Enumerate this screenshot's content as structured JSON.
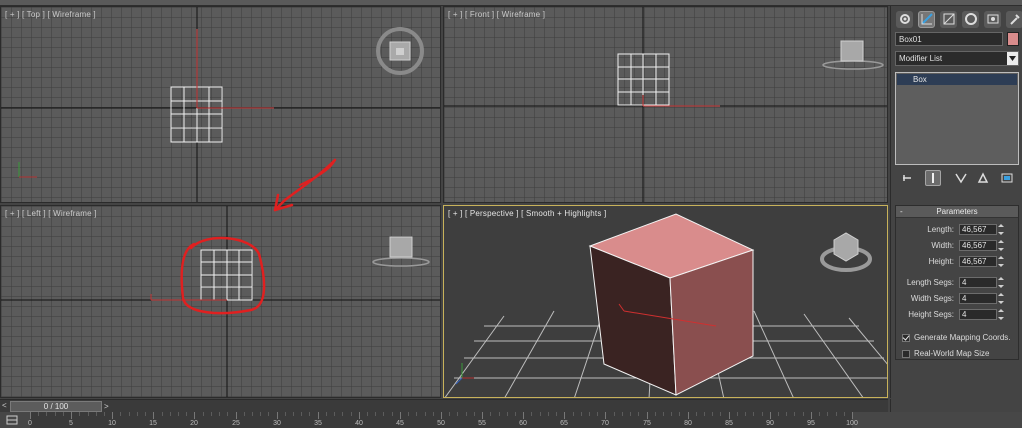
{
  "viewports": {
    "top": {
      "label": "[ + ] [ Top ] [ Wireframe ]"
    },
    "front": {
      "label": "[ + ] [ Front ] [ Wireframe ]"
    },
    "left": {
      "label": "[ + ] [ Left ] [ Wireframe ]"
    },
    "perspective": {
      "label": "[ + ] [ Perspective ] [ Smooth + Highlights ]"
    }
  },
  "command_panel": {
    "tabs": [
      "create-icon",
      "modify-icon",
      "hierarchy-icon",
      "motion-icon",
      "display-icon",
      "utilities-icon"
    ],
    "active_tab": "modify-icon",
    "object_name": "Box01",
    "object_color": "#d98c8c",
    "modifier_list_label": "Modifier List",
    "stack_items": [
      "Box"
    ],
    "stack_tools": [
      "pin-stack-icon",
      "show-end-result-icon",
      "make-unique-icon",
      "remove-modifier-icon",
      "configure-modifier-sets-icon"
    ]
  },
  "parameters": {
    "title": "Parameters",
    "collapse_symbol": "-",
    "length_label": "Length:",
    "length_value": "46,567",
    "width_label": "Width:",
    "width_value": "46,567",
    "height_label": "Height:",
    "height_value": "46,567",
    "length_segs_label": "Length Segs:",
    "length_segs_value": "4",
    "width_segs_label": "Width Segs:",
    "width_segs_value": "4",
    "height_segs_label": "Height Segs:",
    "height_segs_value": "4",
    "gen_mapping_label": "Generate Mapping Coords.",
    "gen_mapping_checked": true,
    "real_world_label": "Real-World Map Size",
    "real_world_checked": false
  },
  "time_slider": {
    "prev": "<",
    "value": "0 / 100",
    "next": ">"
  },
  "track_bar": {
    "ticks": [
      "0",
      "5",
      "10",
      "15",
      "20",
      "25",
      "30",
      "35",
      "40",
      "45",
      "50",
      "55",
      "60",
      "65",
      "70",
      "75",
      "80",
      "85",
      "90",
      "95",
      "100"
    ]
  },
  "colors": {
    "annotation": "#e02020",
    "box_face": "#d98c8c",
    "selection_border": "#c8b25a"
  }
}
